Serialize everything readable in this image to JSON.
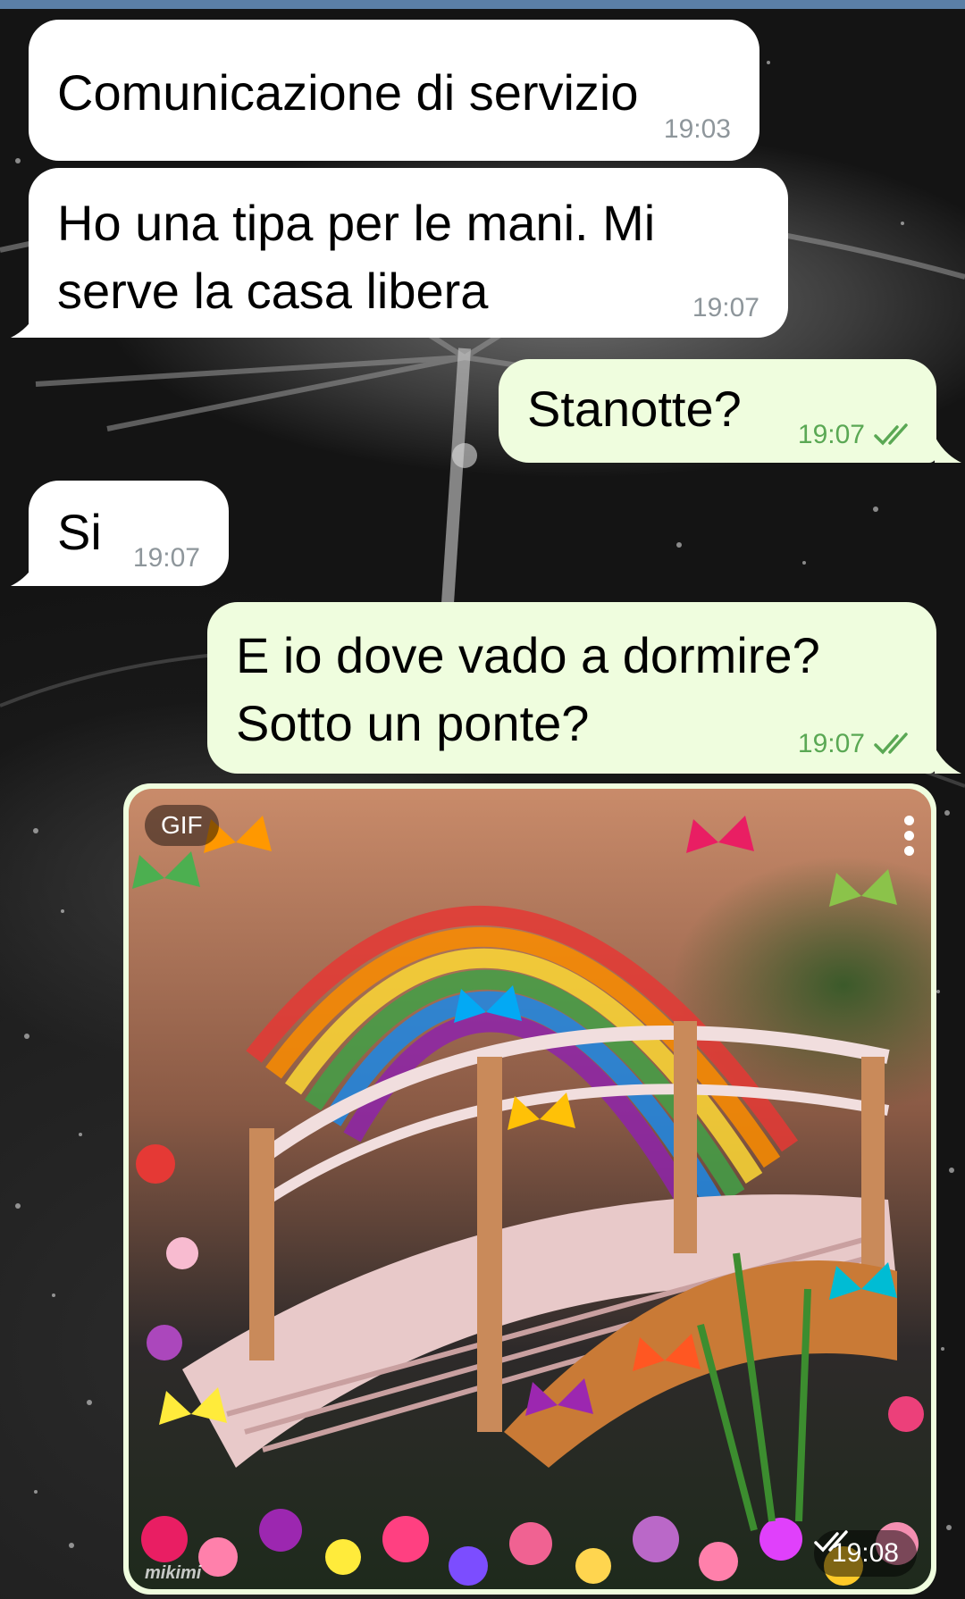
{
  "messages": [
    {
      "text": "Comunicazione di servizio",
      "time": "19:03"
    },
    {
      "text": "Ho una tipa per le mani. Mi\nserve la casa libera",
      "time": "19:07"
    },
    {
      "text": "Stanotte?",
      "time": "19:07"
    },
    {
      "text": "Si",
      "time": "19:07"
    },
    {
      "text": "E io dove vado a dormire?\nSotto un ponte?",
      "time": "19:07"
    }
  ],
  "gif": {
    "badge": "GIF",
    "time": "19:08",
    "watermark": "mikimi"
  },
  "colors": {
    "incoming_bubble": "#ffffff",
    "outgoing_bubble": "#effdde",
    "outgoing_time": "#5aa854",
    "incoming_time": "#8e969b",
    "top_bar": "#5b7fa6"
  },
  "icons": {
    "read_receipt": "double-check-icon",
    "gif_menu": "more-vertical-icon"
  }
}
